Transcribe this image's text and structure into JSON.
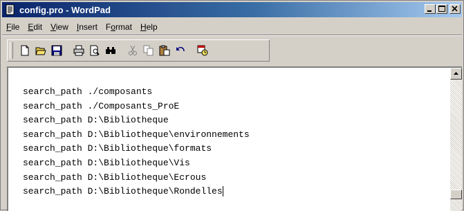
{
  "window": {
    "title": "config.pro - WordPad"
  },
  "menu": [
    {
      "label": "File",
      "accel": "F",
      "rest": "ile"
    },
    {
      "label": "Edit",
      "accel": "E",
      "rest": "dit"
    },
    {
      "label": "View",
      "accel": "V",
      "rest": "iew"
    },
    {
      "label": "Insert",
      "accel": "I",
      "rest": "nsert"
    },
    {
      "label": "Format",
      "accel": "o",
      "pre": "F",
      "rest": "rmat"
    },
    {
      "label": "Help",
      "accel": "H",
      "rest": "elp"
    }
  ],
  "toolbar": [
    "new-icon",
    "open-icon",
    "save-icon",
    "print-icon",
    "print-preview-icon",
    "find-icon",
    "cut-icon",
    "copy-icon",
    "paste-icon",
    "undo-icon",
    "insert-datetime-icon"
  ],
  "document": {
    "lines": [
      "search_path ./composants",
      "search_path ./Composants_ProE",
      "search_path D:\\Bibliotheque",
      "search_path D:\\Bibliotheque\\environnements",
      "search_path D:\\Bibliotheque\\formats",
      "search_path D:\\Bibliotheque\\Vis",
      "search_path D:\\Bibliotheque\\Ecrous",
      "search_path D:\\Bibliotheque\\Rondelles"
    ]
  }
}
